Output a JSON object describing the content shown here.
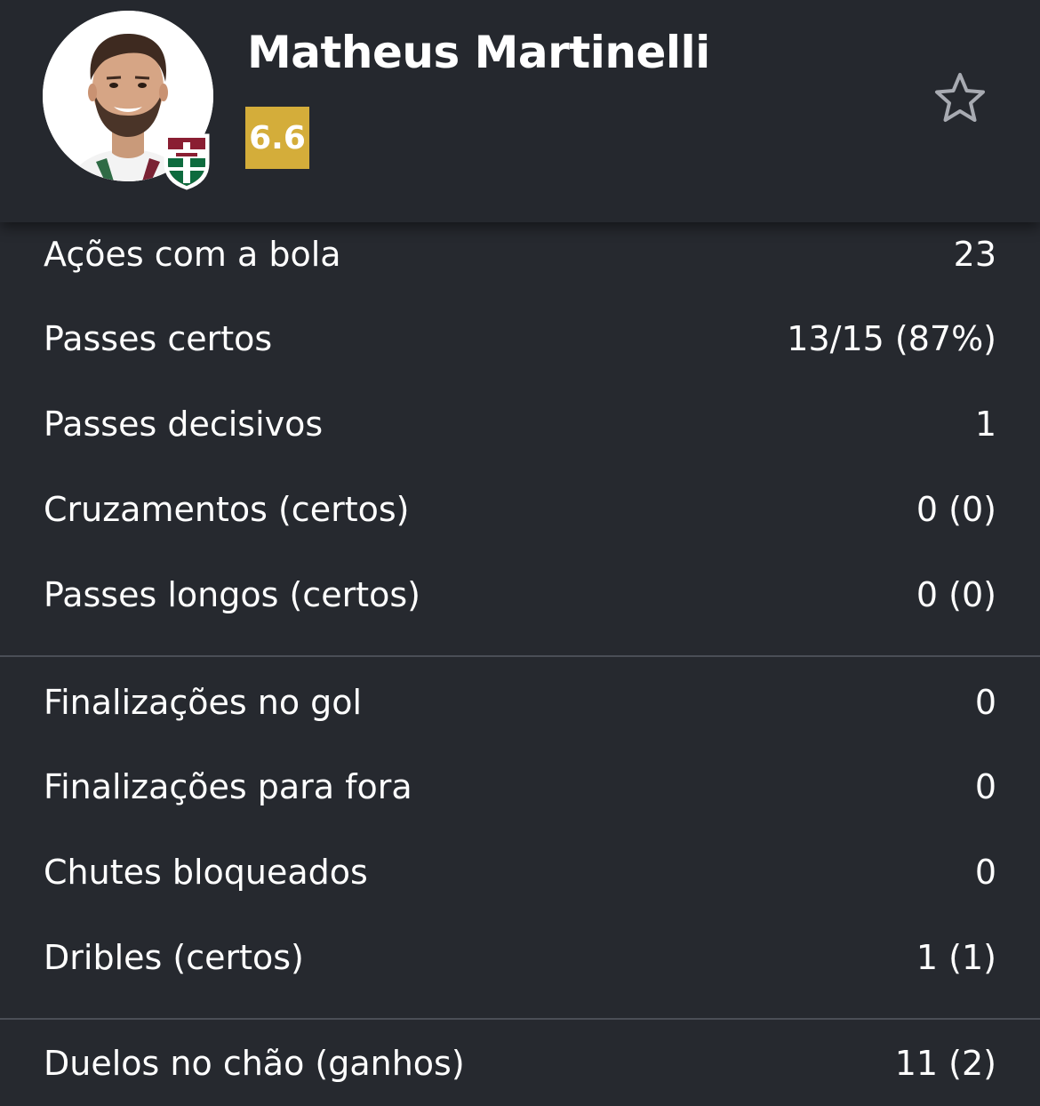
{
  "player": {
    "name": "Matheus Martinelli",
    "rating": "6.6",
    "avatar_icon": "player-photo",
    "club_badge_icon": "fluminense-crest",
    "favorite_icon": "star-outline-icon"
  },
  "colors": {
    "background": "#26292f",
    "rating_badge": "#d4ad3a",
    "divider": "#4a4e56",
    "club_primary": "#8a1e32",
    "club_secondary": "#0e6b3e"
  },
  "stats": {
    "group1": [
      {
        "label": "Ações com a bola",
        "value": "23"
      },
      {
        "label": "Passes certos",
        "value": "13/15 (87%)"
      },
      {
        "label": "Passes decisivos",
        "value": "1"
      },
      {
        "label": "Cruzamentos (certos)",
        "value": "0 (0)"
      },
      {
        "label": "Passes longos (certos)",
        "value": "0 (0)"
      }
    ],
    "group2": [
      {
        "label": "Finalizações no gol",
        "value": "0"
      },
      {
        "label": "Finalizações para fora",
        "value": "0"
      },
      {
        "label": "Chutes bloqueados",
        "value": "0"
      },
      {
        "label": "Dribles (certos)",
        "value": "1 (1)"
      }
    ],
    "group3": [
      {
        "label": "Duelos no chão (ganhos)",
        "value": "11 (2)"
      }
    ]
  }
}
